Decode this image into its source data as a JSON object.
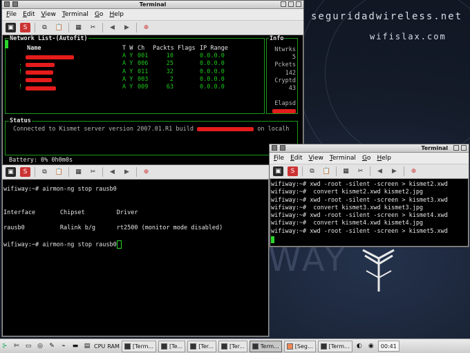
{
  "desktop": {
    "brand_line1": "seguridadwireless.net",
    "brand_line2": "wifislax.com",
    "big_word": "WAY"
  },
  "menu": [
    "File",
    "Edit",
    "View",
    "Terminal",
    "Go",
    "Help"
  ],
  "terminal_title": "Terminal",
  "kismet": {
    "network_list_title": "Network List-(Autofit)",
    "columns": {
      "name": "Name",
      "tw": "T W",
      "ch": "Ch",
      "packets": "Packts",
      "flags": "Flags",
      "ip": "IP Range"
    },
    "rows": [
      {
        "marker": "",
        "name_width": 70,
        "tw": "A Y",
        "ch": "001",
        "packets": "10",
        "ip": "0.0.0.0"
      },
      {
        "marker": ".",
        "name_width": 42,
        "tw": "A Y",
        "ch": "006",
        "packets": "25",
        "ip": "0.0.0.0"
      },
      {
        "marker": "!",
        "name_width": 40,
        "tw": "A Y",
        "ch": "011",
        "packets": "32",
        "ip": "0.0.0.0"
      },
      {
        "marker": "",
        "name_width": 38,
        "tw": "A Y",
        "ch": "003",
        "packets": "2",
        "ip": "0.0.0.0"
      },
      {
        "marker": "!",
        "name_width": 44,
        "tw": "A Y",
        "ch": "009",
        "packets": "63",
        "ip": "0.0.0.0"
      }
    ],
    "info": {
      "title": "Info",
      "networks_label": "Ntwrks",
      "networks": "5",
      "packets_label": "Pckets",
      "packets": "142",
      "crypted_label": "Cryptd",
      "crypted": "43",
      "elapsed_label": "Elapsd"
    },
    "status_title": "Status",
    "status_prefix": "Connected to Kismet server version 2007.01.R1 build",
    "status_suffix": "on localh",
    "battery": "Battery: 0% 0h0m0s"
  },
  "terminal2_lines": [
    "wifiway:~# airmon-ng stop rausb0",
    "",
    "",
    "Interface       Chipset         Driver",
    "",
    "rausb0          Ralink b/g      rt2500 (monitor mode disabled)",
    "",
    "wifiway:~# airmon-ng stop rausb0"
  ],
  "terminal3_lines": [
    "wifiway:~# xwd -root -silent -screen > kismet2.xwd",
    "wifiway:~#  convert kismet2.xwd kismet2.jpg",
    "wifiway:~# xwd -root -silent -screen > kismet3.xwd",
    "wifiway:~#  convert kismet3.xwd kismet3.jpg",
    "wifiway:~# xwd -root -silent -screen > kismet4.xwd",
    "wifiway:~#  convert kismet4.xwd kismet4.jpg",
    "wifiway:~# xwd -root -silent -screen > kismet5.xwd"
  ],
  "taskbar": {
    "cpu_label": "CPU",
    "ram_label": "RAM",
    "tasks": [
      "[Term...",
      "[Te...",
      "[Ter...",
      "[Ter...",
      "Term...",
      "[Seg...",
      "[Term..."
    ],
    "clock": "00:41"
  },
  "colors": {
    "kismet_green": "#1ec81e",
    "cursor_green": "#2bd62b",
    "redaction_red": "#e41c1c"
  }
}
